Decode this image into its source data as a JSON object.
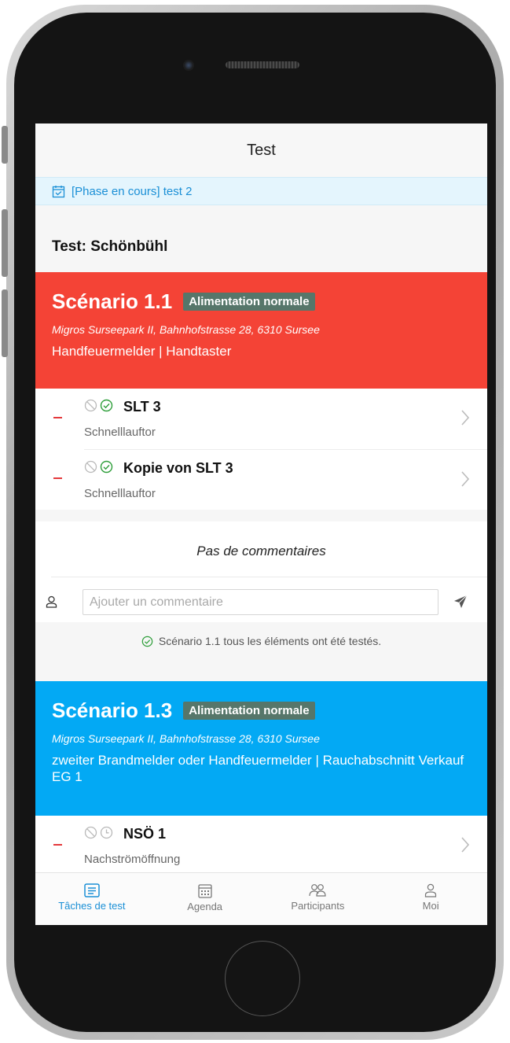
{
  "nav": {
    "title": "Test"
  },
  "phase_banner": {
    "icon": "calendar-check-icon",
    "text": "[Phase en cours] test 2"
  },
  "test_title": "Test: Schönbühl",
  "scenarios": [
    {
      "title": "Scénario 1.1",
      "badge": "Alimentation normale",
      "address": "Migros Surseepark II, Bahnhofstrasse 28, 6310 Sursee",
      "devices": "Handfeuermelder | Handtaster",
      "color": "#f44336",
      "items": [
        {
          "name": "SLT 3",
          "type": "Schnelllauftor",
          "status": "tested"
        },
        {
          "name": "Kopie von SLT 3",
          "type": "Schnelllauftor",
          "status": "tested"
        }
      ],
      "comments": {
        "empty_text": "Pas de commentaires",
        "input_placeholder": "Ajouter un commentaire"
      },
      "tested_note": "Scénario 1.1 tous les éléments ont été testés."
    },
    {
      "title": "Scénario 1.3",
      "badge": "Alimentation normale",
      "address": "Migros Surseepark II, Bahnhofstrasse 28, 6310 Sursee",
      "devices": "zweiter Brandmelder oder Handfeuermelder | Rauchabschnitt Verkauf EG 1",
      "color": "#03a9f4",
      "items": [
        {
          "name": "NSÖ 1",
          "type": "Nachströmöffnung",
          "status": "pending"
        }
      ]
    }
  ],
  "tabs": [
    {
      "label": "Tâches de test",
      "icon": "tasks-icon",
      "active": true
    },
    {
      "label": "Agenda",
      "icon": "calendar-icon",
      "active": false
    },
    {
      "label": "Participants",
      "icon": "participants-icon",
      "active": false
    },
    {
      "label": "Moi",
      "icon": "user-icon",
      "active": false
    }
  ],
  "colors": {
    "accent": "#1a8fd6",
    "danger": "#e4393c",
    "success": "#2e9e3a",
    "badge_bg": "#56766a"
  }
}
